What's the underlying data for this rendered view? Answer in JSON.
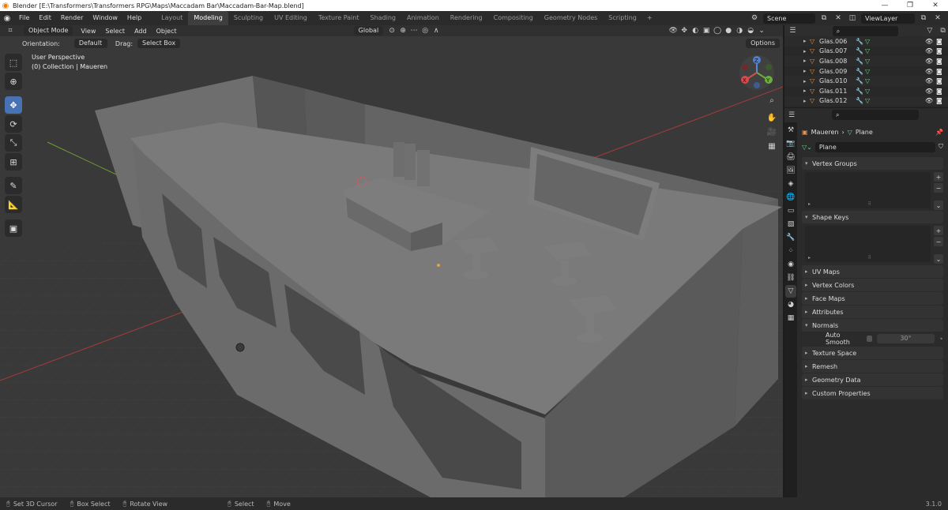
{
  "window": {
    "title": "Blender [E:\\Transformers\\Transformers RPG\\Maps\\Maccadam Bar\\Maccadam-Bar-Map.blend]",
    "controls": [
      "—",
      "❐",
      "✕"
    ]
  },
  "menu": [
    "File",
    "Edit",
    "Render",
    "Window",
    "Help"
  ],
  "workspaces": [
    "Layout",
    "Modeling",
    "Sculpting",
    "UV Editing",
    "Texture Paint",
    "Shading",
    "Animation",
    "Rendering",
    "Compositing",
    "Geometry Nodes",
    "Scripting"
  ],
  "active_workspace": "Modeling",
  "scene": {
    "name": "Scene",
    "view_layer": "ViewLayer"
  },
  "viewport_header": {
    "mode": "Object Mode",
    "menus": [
      "View",
      "Select",
      "Add",
      "Object"
    ],
    "transform_orientation": "Global",
    "orientation_label": "Orientation:",
    "orientation_value": "Default",
    "drag_label": "Drag:",
    "drag_value": "Select Box",
    "options": "Options"
  },
  "viewport_info": {
    "perspective": "User Perspective",
    "collection": "(0) Collection | Maueren"
  },
  "gizmo": {
    "z": "Z",
    "y": "Y",
    "x": "X"
  },
  "outliner": {
    "items": [
      {
        "name": "Glas.006"
      },
      {
        "name": "Glas.007"
      },
      {
        "name": "Glas.008"
      },
      {
        "name": "Glas.009"
      },
      {
        "name": "Glas.010"
      },
      {
        "name": "Glas.011"
      },
      {
        "name": "Glas.012"
      }
    ]
  },
  "properties": {
    "breadcrumb_object": "Maueren",
    "breadcrumb_data": "Plane",
    "mesh_name": "Plane",
    "panels": {
      "vertex_groups": "Vertex Groups",
      "shape_keys": "Shape Keys",
      "uv_maps": "UV Maps",
      "vertex_colors": "Vertex Colors",
      "face_maps": "Face Maps",
      "attributes": "Attributes",
      "normals": "Normals",
      "texture_space": "Texture Space",
      "remesh": "Remesh",
      "geometry_data": "Geometry Data",
      "custom_properties": "Custom Properties"
    },
    "auto_smooth_label": "Auto Smooth",
    "auto_smooth_angle": "30°"
  },
  "statusbar": {
    "items": [
      "Set 3D Cursor",
      "Box Select",
      "Rotate View",
      "Select",
      "Move"
    ],
    "version": "3.1.0"
  },
  "colors": {
    "accent": "#4772b3",
    "brand": "#e87d0d"
  }
}
